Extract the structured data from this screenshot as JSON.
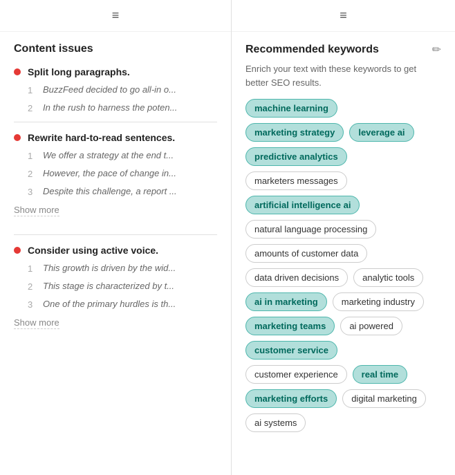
{
  "left": {
    "hamburger": "≡",
    "section_title": "Content issues",
    "groups": [
      {
        "id": "group-1",
        "title": "Split long paragraphs.",
        "items": [
          {
            "number": "1",
            "text": "BuzzFeed decided to go all-in o..."
          },
          {
            "number": "2",
            "text": "In the rush to harness the poten..."
          }
        ],
        "show_more": false
      },
      {
        "id": "group-2",
        "title": "Rewrite hard-to-read sentences.",
        "items": [
          {
            "number": "1",
            "text": "We offer a strategy at the end t..."
          },
          {
            "number": "2",
            "text": "However, the pace of change in..."
          },
          {
            "number": "3",
            "text": "Despite this challenge, a report ..."
          }
        ],
        "show_more": true,
        "show_more_label": "Show more"
      },
      {
        "id": "group-3",
        "title": "Consider using active voice.",
        "items": [
          {
            "number": "1",
            "text": "This growth is driven by the wid..."
          },
          {
            "number": "2",
            "text": "This stage is characterized by t..."
          },
          {
            "number": "3",
            "text": "One of the primary hurdles is th..."
          }
        ],
        "show_more": true,
        "show_more_label": "Show more"
      }
    ]
  },
  "right": {
    "hamburger": "≡",
    "section_title": "Recommended keywords",
    "subtitle": "Enrich your text with these keywords to get better SEO results.",
    "edit_icon": "✏",
    "keywords": [
      {
        "label": "machine learning",
        "highlighted": true
      },
      {
        "label": "marketing strategy",
        "highlighted": true
      },
      {
        "label": "leverage ai",
        "highlighted": true
      },
      {
        "label": "predictive analytics",
        "highlighted": true
      },
      {
        "label": "marketers messages",
        "highlighted": false
      },
      {
        "label": "artificial intelligence ai",
        "highlighted": true
      },
      {
        "label": "natural language processing",
        "highlighted": false
      },
      {
        "label": "amounts of customer data",
        "highlighted": false
      },
      {
        "label": "data driven decisions",
        "highlighted": false
      },
      {
        "label": "analytic tools",
        "highlighted": false
      },
      {
        "label": "ai in marketing",
        "highlighted": true
      },
      {
        "label": "marketing industry",
        "highlighted": false
      },
      {
        "label": "marketing teams",
        "highlighted": true
      },
      {
        "label": "ai powered",
        "highlighted": false
      },
      {
        "label": "customer service",
        "highlighted": true
      },
      {
        "label": "customer experience",
        "highlighted": false
      },
      {
        "label": "real time",
        "highlighted": true
      },
      {
        "label": "marketing efforts",
        "highlighted": true
      },
      {
        "label": "digital marketing",
        "highlighted": false
      },
      {
        "label": "ai systems",
        "highlighted": false
      }
    ]
  }
}
